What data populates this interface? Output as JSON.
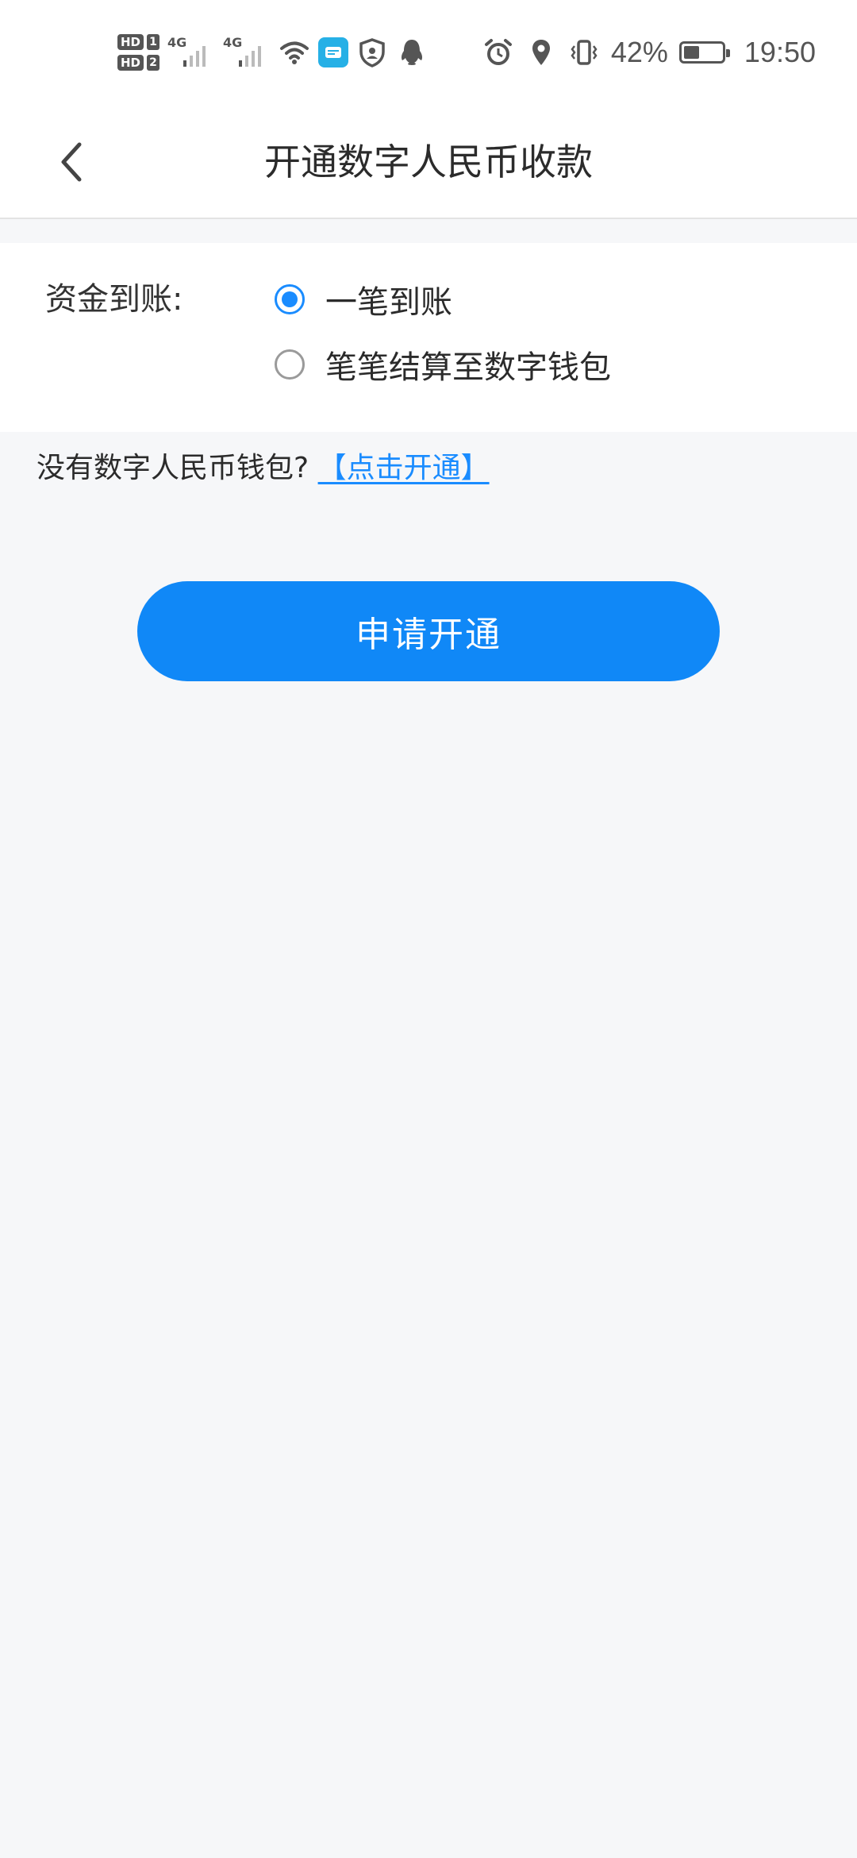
{
  "status_bar": {
    "hd1": "HD",
    "sim1": "1",
    "hd2": "HD",
    "sim2": "2",
    "net1": "4G",
    "net2": "4G",
    "battery_percent": "42%",
    "battery_level": 0.42,
    "time": "19:50",
    "icons": [
      "wifi-icon",
      "app-notification-icon",
      "shield-icon",
      "qq-penguin-icon",
      "alarm-icon",
      "location-icon",
      "vibrate-icon",
      "battery-icon"
    ]
  },
  "nav": {
    "title": "开通数字人民币收款",
    "back_icon": "chevron-left-icon"
  },
  "settlement": {
    "label": "资金到账:",
    "options": [
      {
        "label": "一笔到账",
        "selected": true
      },
      {
        "label": "笔笔结算至数字钱包",
        "selected": false
      }
    ]
  },
  "hint": {
    "text": "没有数字人民币钱包?",
    "link": "【点击开通】"
  },
  "actions": {
    "apply_label": "申请开通"
  },
  "colors": {
    "accent": "#1088f7",
    "link": "#1a8cff",
    "background": "#f6f7f9"
  }
}
